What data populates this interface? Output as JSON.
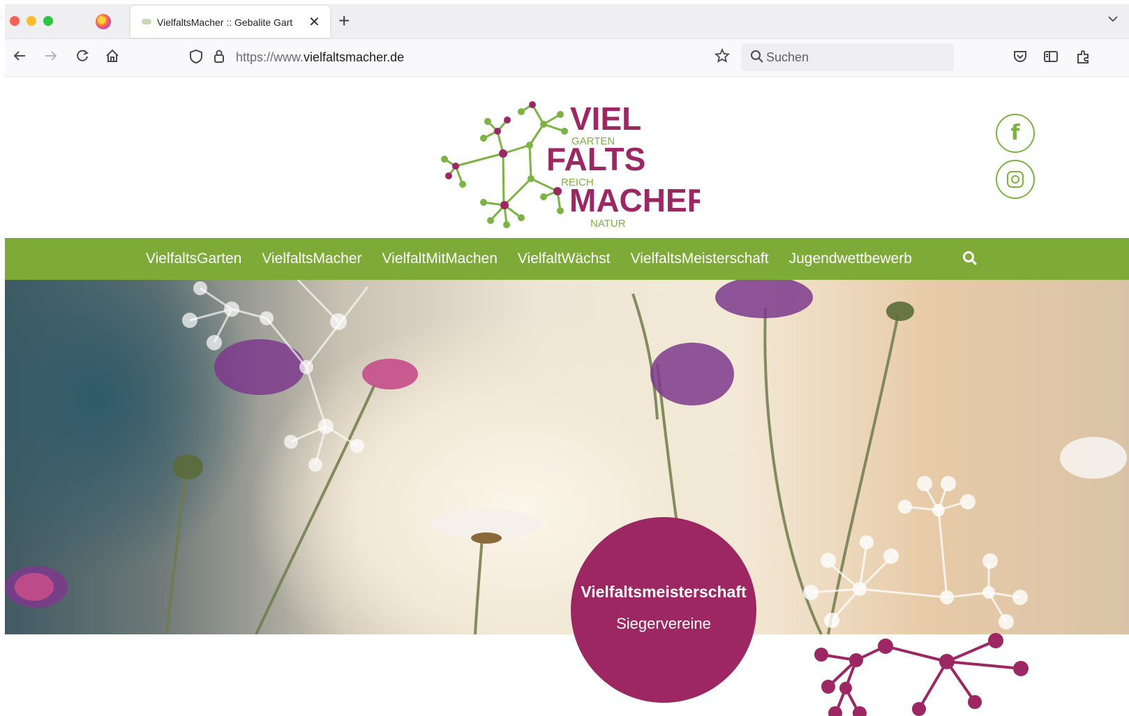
{
  "browser": {
    "tab_title": "VielfaltsMacher :: Gebalite Gart",
    "tab_close": "✕",
    "new_tab": "+",
    "tab_list_icon": "chevron-down-icon",
    "url_prefix": "https://www.",
    "url_domain": "vielfaltsmacher.de",
    "search_placeholder": "Suchen"
  },
  "logo": {
    "line1": "VIEL",
    "small1": "GARTEN",
    "line2": "FALTS",
    "small2": "REICH",
    "line3": "MACHER",
    "small3": "NATUR"
  },
  "social": {
    "facebook": "f"
  },
  "nav": {
    "items": [
      "VielfaltsGarten",
      "VielfaltsMacher",
      "VielfaltMitMachen",
      "VielfaltWächst",
      "VielfaltsMeisterschaft",
      "Jugendwettbewerb"
    ]
  },
  "hero": {
    "badge_title": "Vielfaltsmeisterschaft",
    "badge_subtitle": "Siegervereine"
  },
  "colors": {
    "brand_green": "#7eab38",
    "brand_purple": "#9c2763"
  }
}
